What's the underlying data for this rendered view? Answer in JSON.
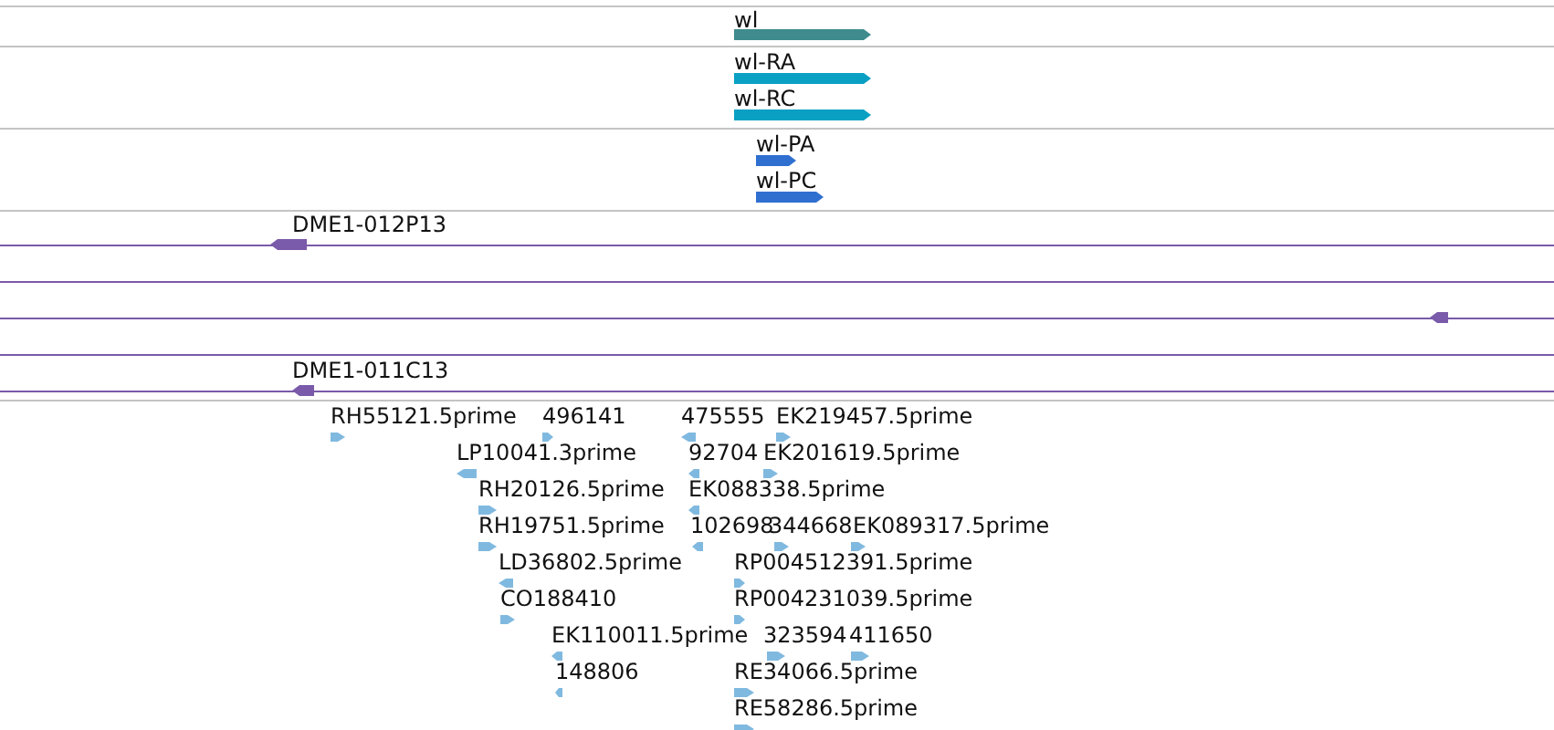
{
  "tracks": [
    {
      "kind": "gene",
      "features": [
        {
          "label": "wl",
          "forward": true
        }
      ]
    },
    {
      "kind": "transcript",
      "features": [
        {
          "label": "wl-RA",
          "forward": true
        },
        {
          "label": "wl-RC",
          "forward": true
        }
      ]
    },
    {
      "kind": "protein",
      "features": [
        {
          "label": "wl-PA",
          "forward": true
        },
        {
          "label": "wl-PC",
          "forward": true
        }
      ]
    },
    {
      "kind": "clone",
      "features": [
        {
          "label": "DME1-012P13",
          "forward": false
        },
        {
          "forward": false
        },
        {
          "label": "DME1-011C13",
          "forward": false
        }
      ]
    },
    {
      "kind": "est",
      "features": [
        {
          "label": "RH55121.5prime",
          "forward": true
        },
        {
          "label": "496141",
          "forward": true
        },
        {
          "label": "475555",
          "forward": false
        },
        {
          "label": "EK219457.5prime",
          "forward": true
        },
        {
          "label": "LP10041.3prime",
          "forward": false
        },
        {
          "label": "92704",
          "forward": false
        },
        {
          "label": "EK201619.5prime",
          "forward": true
        },
        {
          "label": "RH20126.5prime",
          "forward": true
        },
        {
          "label": "EK088338.5prime",
          "forward": false
        },
        {
          "label": "RH19751.5prime",
          "forward": true
        },
        {
          "label": "102698",
          "forward": false
        },
        {
          "label": "344668",
          "forward": true
        },
        {
          "label": "EK089317.5prime",
          "forward": true
        },
        {
          "label": "LD36802.5prime",
          "forward": false
        },
        {
          "label": "RP004512391.5prime",
          "forward": true
        },
        {
          "label": "CO188410",
          "forward": true
        },
        {
          "label": "RP004231039.5prime",
          "forward": true
        },
        {
          "label": "EK110011.5prime",
          "forward": false
        },
        {
          "label": "323594",
          "forward": true
        },
        {
          "label": "411650",
          "forward": true
        },
        {
          "label": "148806",
          "forward": false
        },
        {
          "label": "RE34066.5prime",
          "forward": true
        },
        {
          "label": "RE58286.5prime",
          "forward": true
        }
      ]
    }
  ]
}
